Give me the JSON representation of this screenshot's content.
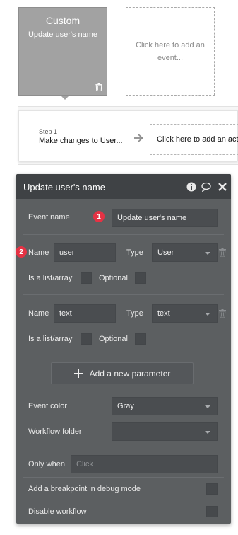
{
  "event_card": {
    "type": "Custom",
    "name": "Update user's name"
  },
  "add_event": {
    "label": "Click here to add an event..."
  },
  "steps": {
    "step_label": "Step 1",
    "step_title": "Make changes to User...",
    "add_action_label": "Click here to add an action..."
  },
  "panel": {
    "title": "Update user's name",
    "icons": [
      "info-icon",
      "comment-icon",
      "close-icon"
    ],
    "event_name_label": "Event name",
    "event_name_value": "Update user's name",
    "parameters": [
      {
        "name_label": "Name",
        "name_value": "user",
        "type_label": "Type",
        "type_value": "User",
        "is_list_label": "Is a list/array",
        "optional_label": "Optional"
      },
      {
        "name_label": "Name",
        "name_value": "text",
        "type_label": "Type",
        "type_value": "text",
        "is_list_label": "Is a list/array",
        "optional_label": "Optional"
      }
    ],
    "add_parameter_label": "Add a new parameter",
    "event_color_label": "Event color",
    "event_color_value": "Gray",
    "workflow_folder_label": "Workflow folder",
    "workflow_folder_value": "",
    "only_when_label": "Only when",
    "only_when_placeholder": "Click",
    "breakpoint_label": "Add a breakpoint in debug mode",
    "disable_label": "Disable workflow"
  },
  "annotations": {
    "badge_1": "1",
    "badge_2": "2",
    "badge_color": "#e53244"
  },
  "colors": {
    "panel_bg": "#5c5f61",
    "panel_header_bg": "#3f4245",
    "event_card_bg": "#a2a2a2"
  }
}
